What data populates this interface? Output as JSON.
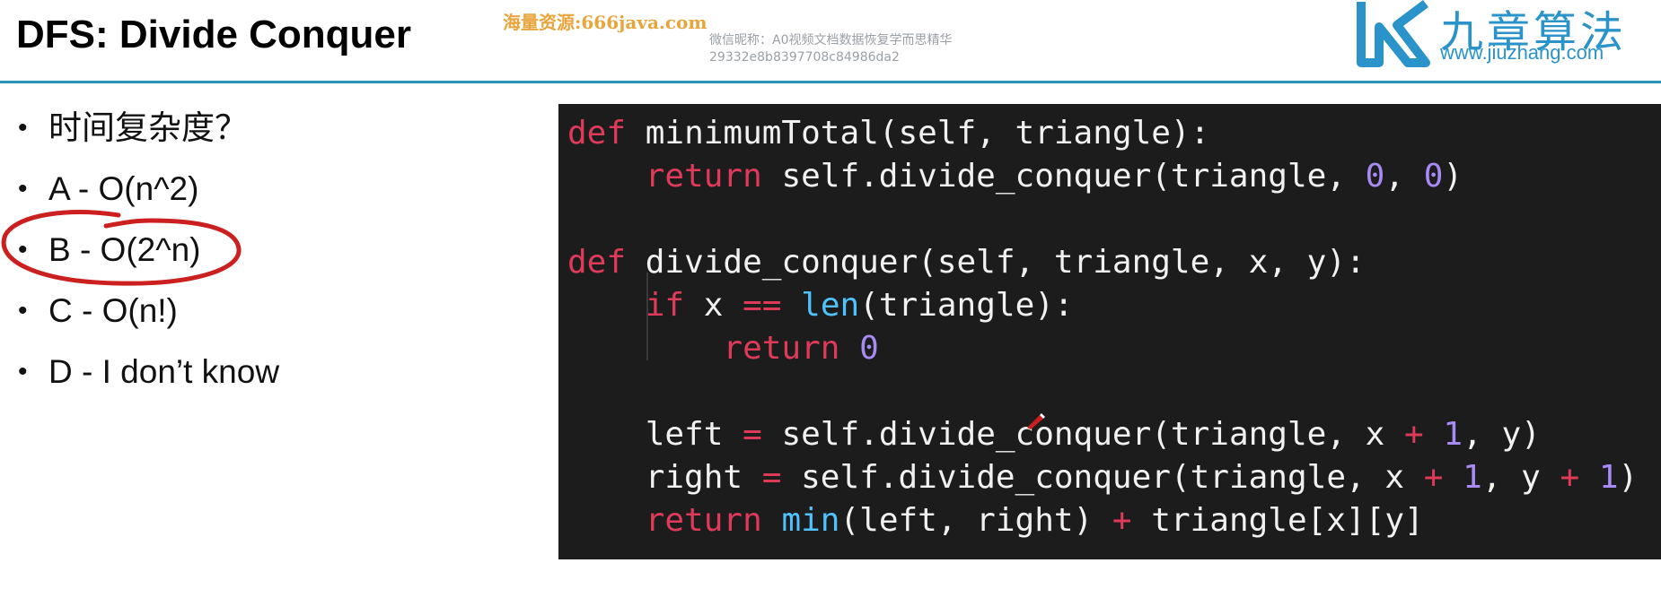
{
  "header": {
    "title": "DFS: Divide Conquer",
    "watermark_top": "海量资源:666java.com",
    "watermark_line1": "微信昵称：A0视频文档数据恢复学而思精华",
    "watermark_line2": "29332e8b8397708c84986da2"
  },
  "logo": {
    "text_cn": "九章算法",
    "url": "www.jiuzhang.com",
    "color": "#2a93c9"
  },
  "bullets": [
    {
      "label": "时间复杂度？"
    },
    {
      "label": "A - O(n^2)"
    },
    {
      "label": "B - O(2^n)"
    },
    {
      "label": "C - O(n!)"
    },
    {
      "label": "D - I don’t know"
    }
  ],
  "annotation": {
    "circled_option": "B - O(2^n)",
    "color": "#cc1f1f"
  },
  "code": {
    "language": "python",
    "lines": [
      "def minimumTotal(self, triangle):",
      "    return self.divide_conquer(triangle, 0, 0)",
      "",
      "def divide_conquer(self, triangle, x, y):",
      "    if x == len(triangle):",
      "        return 0",
      "",
      "    left = self.divide_conquer(triangle, x + 1, y)",
      "    right = self.divide_conquer(triangle, x + 1, y + 1)",
      "    return min(left, right) + triangle[x][y]"
    ],
    "tokens": {
      "def": "def",
      "return": "return",
      "if": "if",
      "eq": "==",
      "assign": "=",
      "plus": "+",
      "zero": "0",
      "one": "1",
      "len": "len",
      "min": "min",
      "fn_minimumTotal": "minimumTotal",
      "fn_divide_conquer": "divide_conquer",
      "args_mt": "(self, triangle):",
      "args_dc": "(self, triangle, x, y):",
      "self_call": "self.divide_conquer(triangle,",
      "comma_sp": ", ",
      "close_paren": ")",
      "x_sp": " x ",
      "y_sp": " y ",
      "y_close": " y)",
      "len_arg": "(triangle):",
      "left_var": "left ",
      "right_var": "right ",
      "min_args": "(left, right) ",
      "triangle_idx": " triangle[x][y]",
      "comma_y": ", y ",
      "one_close": ")"
    },
    "colors": {
      "background": "#1c1c1c",
      "keyword": "#e03a59",
      "number": "#a98bf5",
      "builtin": "#4ec3ff",
      "text": "#f1f1f1"
    }
  }
}
